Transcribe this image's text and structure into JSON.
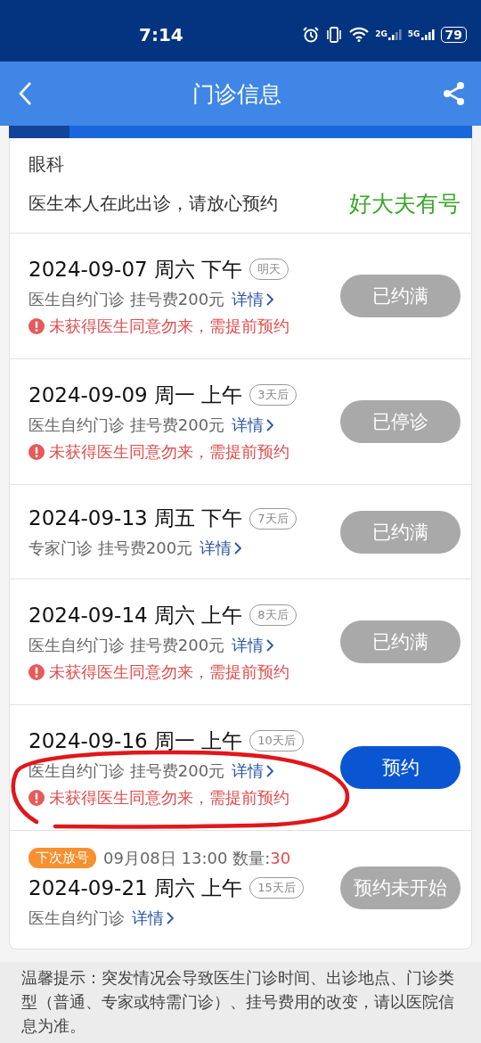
{
  "status_bar": {
    "time": "7:14",
    "battery": "79",
    "network_1": "2G",
    "network_2": "5G"
  },
  "header": {
    "title": "门诊信息"
  },
  "department": {
    "name": "眼科",
    "note": "医生本人在此出诊，请放心预约",
    "badge": "好大夫有号"
  },
  "schedules": [
    {
      "date": "2024-09-07 周六 下午",
      "relative": "明天",
      "info": "医生自约门诊 挂号费200元",
      "details_link": "详情",
      "warning": "未获得医生同意勿来，需提前预约",
      "button": {
        "label": "已约满",
        "disabled": true
      }
    },
    {
      "date": "2024-09-09 周一 上午",
      "relative": "3天后",
      "info": "医生自约门诊 挂号费200元",
      "details_link": "详情",
      "warning": "未获得医生同意勿来，需提前预约",
      "button": {
        "label": "已停诊",
        "disabled": true
      }
    },
    {
      "date": "2024-09-13 周五 下午",
      "relative": "7天后",
      "info": "专家门诊 挂号费200元",
      "details_link": "详情",
      "button": {
        "label": "已约满",
        "disabled": true
      }
    },
    {
      "date": "2024-09-14 周六 上午",
      "relative": "8天后",
      "info": "医生自约门诊 挂号费200元",
      "details_link": "详情",
      "warning": "未获得医生同意勿来，需提前预约",
      "button": {
        "label": "已约满",
        "disabled": true
      }
    },
    {
      "date": "2024-09-16 周一 上午",
      "relative": "10天后",
      "info": "医生自约门诊 挂号费200元",
      "details_link": "详情",
      "warning": "未获得医生同意勿来，需提前预约",
      "button": {
        "label": "预约",
        "disabled": false
      },
      "annotated": true
    },
    {
      "next_release": {
        "tag": "下次放号",
        "time": "09月08日 13:00",
        "quantity_label": "数量:",
        "quantity": "30"
      },
      "date": "2024-09-21 周六 上午",
      "relative": "15天后",
      "info": "医生自约门诊",
      "details_link": "详情",
      "button": {
        "label": "预约未开始",
        "disabled": true
      }
    }
  ],
  "footer_note": "温馨提示：突发情况会导致医生门诊时间、出诊地点、门诊类型（普通、专家或特需门诊）、挂号费用的改变，请以医院信息为准。"
}
